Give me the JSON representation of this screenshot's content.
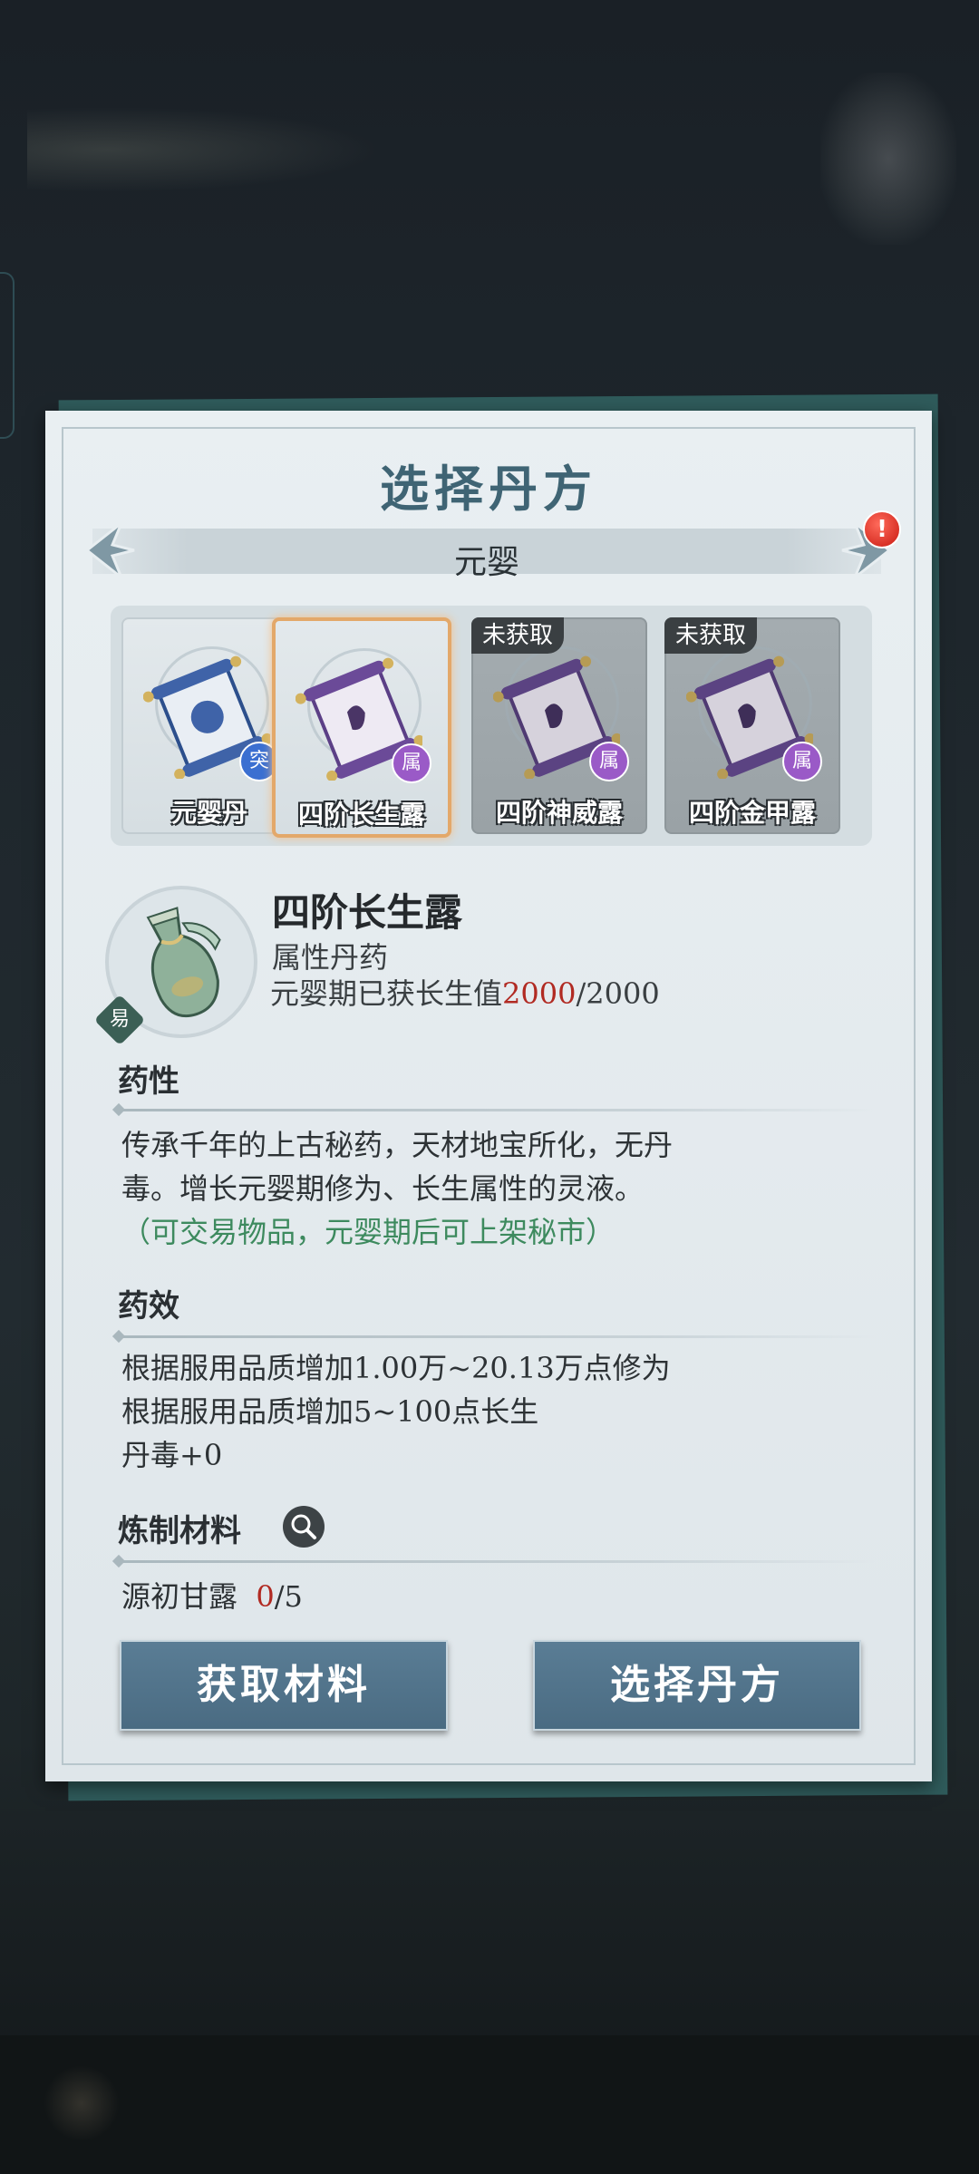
{
  "dialog": {
    "title": "选择丹方",
    "realm": "元婴",
    "alert_badge": "!"
  },
  "recipes": [
    {
      "name": "元婴丹",
      "type_badge": "突",
      "tag": "",
      "selected": false,
      "locked": false
    },
    {
      "name": "四阶长生露",
      "type_badge": "属",
      "tag": "",
      "selected": true,
      "locked": false
    },
    {
      "name": "四阶神威露",
      "type_badge": "属",
      "tag": "未获取",
      "selected": false,
      "locked": true
    },
    {
      "name": "四阶金甲露",
      "type_badge": "属",
      "tag": "未获取",
      "selected": false,
      "locked": true
    }
  ],
  "detail": {
    "name": "四阶长生露",
    "category": "属性丹药",
    "progress_label": "元婴期已获长生值",
    "progress_current": "2000",
    "progress_sep": "/",
    "progress_max": "2000",
    "easy_badge": "易"
  },
  "properties": {
    "title": "药性",
    "line1": "传承千年的上古秘药，天材地宝所化，无丹",
    "line2": "毒。增长元婴期修为、长生属性的灵液。",
    "note": "（可交易物品，元婴期后可上架秘市）"
  },
  "effects": {
    "title": "药效",
    "lines": [
      "根据服用品质增加1.00万~20.13万点修为",
      "根据服用品质增加5~100点长生",
      "丹毒+0"
    ]
  },
  "materials": {
    "title": "炼制材料",
    "items": [
      {
        "name": "源初甘露",
        "have": "0",
        "sep": "/",
        "need": "5"
      }
    ]
  },
  "buttons": {
    "get_materials": "获取材料",
    "select_recipe": "选择丹方"
  },
  "colors": {
    "title": "#3f6474",
    "button": "#4a6b82",
    "highlight": "#e3a86a",
    "red_value": "#b12a22",
    "green_note": "#3d8a5e"
  }
}
